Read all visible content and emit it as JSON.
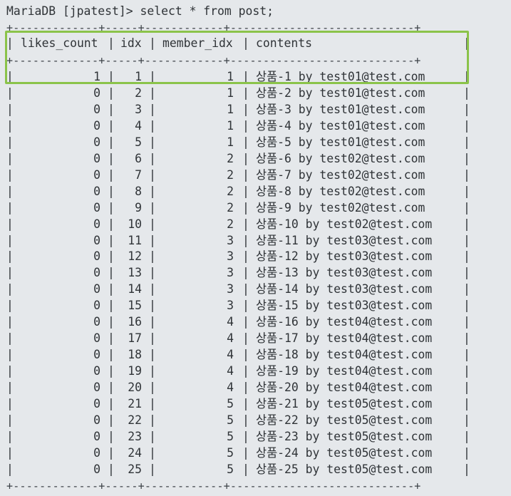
{
  "terminal": {
    "prompt": "MariaDB [jpatest]> select * from post;",
    "border_top": "+-------------+-----+------------+----------------------------+",
    "border_mid": "+-------------+-----+------------+----------------------------+",
    "border_bottom": "+-------------+-----+------------+----------------------------+",
    "columns": [
      "likes_count",
      "idx",
      "member_idx",
      "contents"
    ],
    "rows": [
      [
        "1",
        "1",
        "1",
        "상품-1 by test01@test.com"
      ],
      [
        "0",
        "2",
        "1",
        "상품-2 by test01@test.com"
      ],
      [
        "0",
        "3",
        "1",
        "상품-3 by test01@test.com"
      ],
      [
        "0",
        "4",
        "1",
        "상품-4 by test01@test.com"
      ],
      [
        "0",
        "5",
        "1",
        "상품-5 by test01@test.com"
      ],
      [
        "0",
        "6",
        "2",
        "상품-6 by test02@test.com"
      ],
      [
        "0",
        "7",
        "2",
        "상품-7 by test02@test.com"
      ],
      [
        "0",
        "8",
        "2",
        "상품-8 by test02@test.com"
      ],
      [
        "0",
        "9",
        "2",
        "상품-9 by test02@test.com"
      ],
      [
        "0",
        "10",
        "2",
        "상품-10 by test02@test.com"
      ],
      [
        "0",
        "11",
        "3",
        "상품-11 by test03@test.com"
      ],
      [
        "0",
        "12",
        "3",
        "상품-12 by test03@test.com"
      ],
      [
        "0",
        "13",
        "3",
        "상품-13 by test03@test.com"
      ],
      [
        "0",
        "14",
        "3",
        "상품-14 by test03@test.com"
      ],
      [
        "0",
        "15",
        "3",
        "상품-15 by test03@test.com"
      ],
      [
        "0",
        "16",
        "4",
        "상품-16 by test04@test.com"
      ],
      [
        "0",
        "17",
        "4",
        "상품-17 by test04@test.com"
      ],
      [
        "0",
        "18",
        "4",
        "상품-18 by test04@test.com"
      ],
      [
        "0",
        "19",
        "4",
        "상품-19 by test04@test.com"
      ],
      [
        "0",
        "20",
        "4",
        "상품-20 by test04@test.com"
      ],
      [
        "0",
        "21",
        "5",
        "상품-21 by test05@test.com"
      ],
      [
        "0",
        "22",
        "5",
        "상품-22 by test05@test.com"
      ],
      [
        "0",
        "23",
        "5",
        "상품-23 by test05@test.com"
      ],
      [
        "0",
        "24",
        "5",
        "상품-24 by test05@test.com"
      ],
      [
        "0",
        "25",
        "5",
        "상품-25 by test05@test.com"
      ]
    ]
  },
  "colors": {
    "background": "#e5e8eb",
    "text": "#2f3337",
    "highlight_border": "#8bc34a"
  }
}
